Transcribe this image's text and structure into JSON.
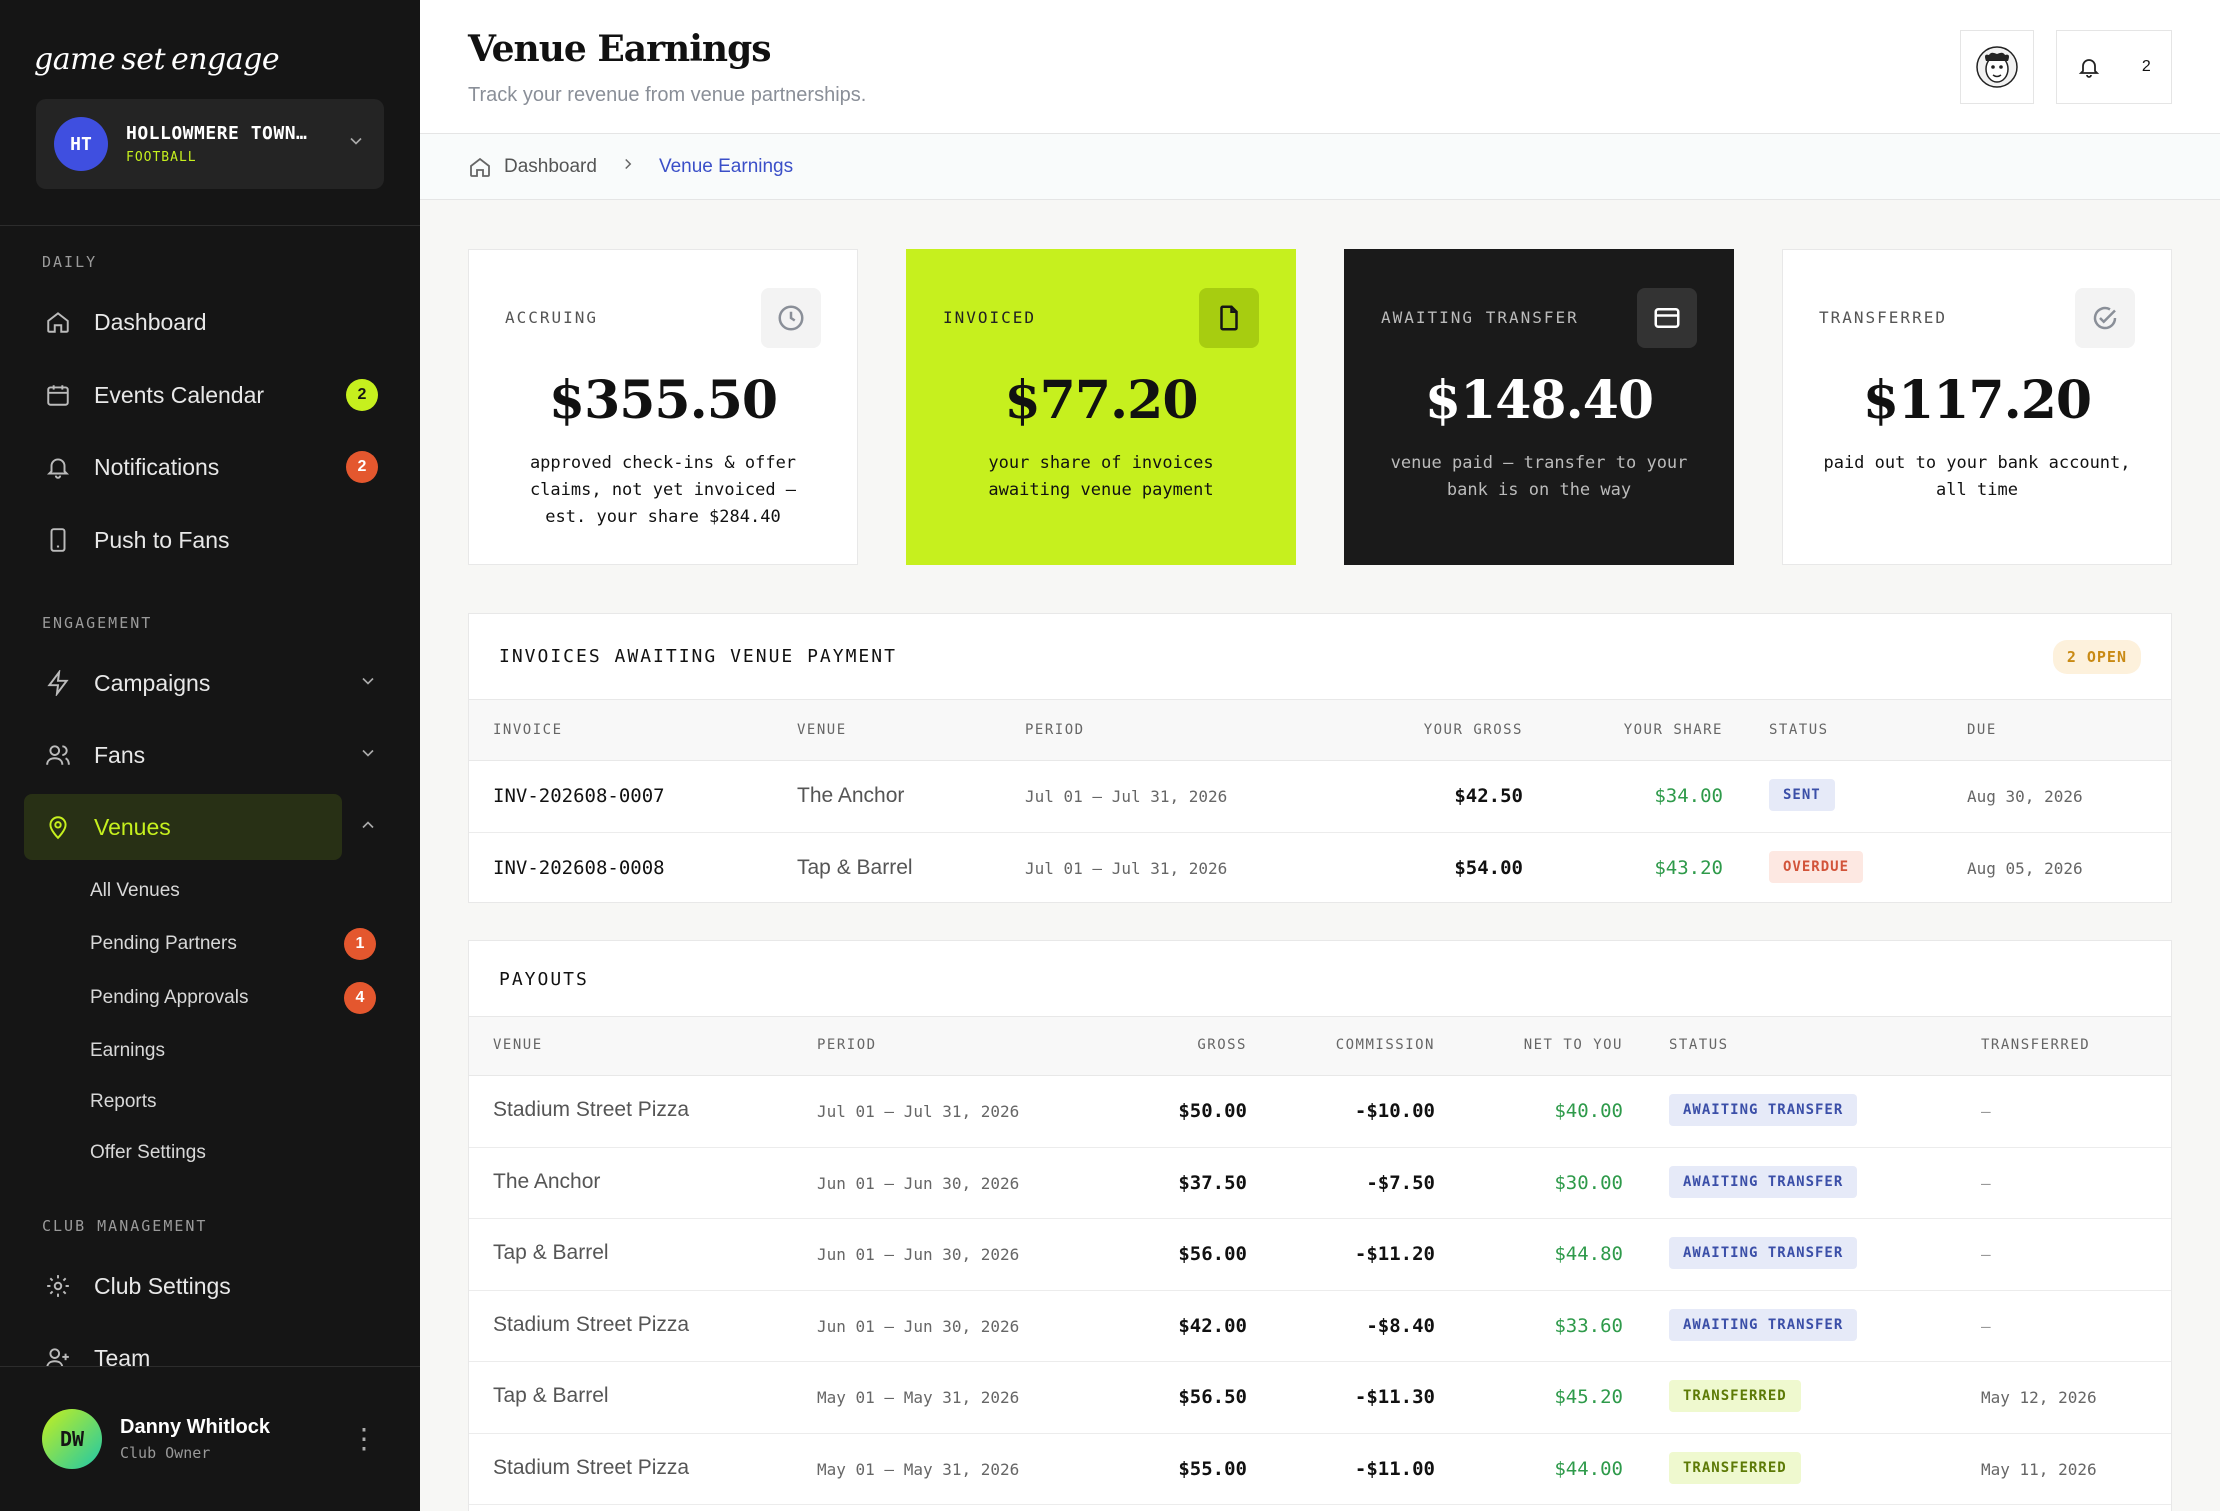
{
  "brand": {
    "logo_words": [
      "game",
      "set",
      "engage"
    ]
  },
  "club": {
    "initials": "HT",
    "name": "HOLLOWMERE TOWN…",
    "sport": "FOOTBALL"
  },
  "sidebar": {
    "sections": {
      "daily": "DAILY",
      "engagement": "ENGAGEMENT",
      "club": "CLUB MANAGEMENT"
    },
    "items": {
      "dashboard": "Dashboard",
      "events": {
        "label": "Events Calendar",
        "badge": "2"
      },
      "notifications": {
        "label": "Notifications",
        "badge": "2"
      },
      "push": "Push to Fans",
      "campaigns": "Campaigns",
      "fans": "Fans",
      "venues": "Venues",
      "club_settings": "Club Settings",
      "team": "Team"
    },
    "venue_sub": {
      "all": "All Venues",
      "pending_partners": {
        "label": "Pending Partners",
        "badge": "1"
      },
      "pending_approvals": {
        "label": "Pending Approvals",
        "badge": "4"
      },
      "earnings": "Earnings",
      "reports": "Reports",
      "offer_settings": "Offer Settings"
    }
  },
  "user": {
    "initials": "DW",
    "name": "Danny Whitlock",
    "role": "Club Owner"
  },
  "header": {
    "title": "Venue Earnings",
    "subtitle": "Track your revenue from venue partnerships.",
    "notif_count": "2"
  },
  "breadcrumb": {
    "home": "Dashboard",
    "current": "Venue Earnings"
  },
  "cards": [
    {
      "label": "ACCRUING",
      "amount": "$355.50",
      "desc": "approved check-ins & offer claims, not yet invoiced — est. your share $284.40",
      "icon": "clock-icon"
    },
    {
      "label": "INVOICED",
      "amount": "$77.20",
      "desc": "your share of invoices awaiting venue payment",
      "icon": "document-icon"
    },
    {
      "label": "AWAITING TRANSFER",
      "amount": "$148.40",
      "desc": "venue paid — transfer to your bank is on the way",
      "icon": "credit-card-icon"
    },
    {
      "label": "TRANSFERRED",
      "amount": "$117.20",
      "desc": "paid out to your bank account, all time",
      "icon": "check-circle-icon"
    }
  ],
  "invoices": {
    "title": "INVOICES AWAITING VENUE PAYMENT",
    "badge": "2 OPEN",
    "columns": [
      "INVOICE",
      "VENUE",
      "PERIOD",
      "YOUR GROSS",
      "YOUR SHARE",
      "STATUS",
      "DUE"
    ],
    "rows": [
      {
        "invoice": "INV-202608-0007",
        "venue": "The Anchor",
        "period": "Jul 01 — Jul 31, 2026",
        "gross": "$42.50",
        "share": "$34.00",
        "status": "SENT",
        "due": "Aug 30, 2026"
      },
      {
        "invoice": "INV-202608-0008",
        "venue": "Tap & Barrel",
        "period": "Jul 01 — Jul 31, 2026",
        "gross": "$54.00",
        "share": "$43.20",
        "status": "OVERDUE",
        "due": "Aug 05, 2026"
      }
    ]
  },
  "payouts": {
    "title": "PAYOUTS",
    "columns": [
      "VENUE",
      "PERIOD",
      "GROSS",
      "COMMISSION",
      "NET TO YOU",
      "STATUS",
      "TRANSFERRED"
    ],
    "rows": [
      {
        "venue": "Stadium Street Pizza",
        "period": "Jul 01 — Jul 31, 2026",
        "gross": "$50.00",
        "commission": "-$10.00",
        "net": "$40.00",
        "status": "AWAITING TRANSFER",
        "transferred": "—"
      },
      {
        "venue": "The Anchor",
        "period": "Jun 01 — Jun 30, 2026",
        "gross": "$37.50",
        "commission": "-$7.50",
        "net": "$30.00",
        "status": "AWAITING TRANSFER",
        "transferred": "—"
      },
      {
        "venue": "Tap & Barrel",
        "period": "Jun 01 — Jun 30, 2026",
        "gross": "$56.00",
        "commission": "-$11.20",
        "net": "$44.80",
        "status": "AWAITING TRANSFER",
        "transferred": "—"
      },
      {
        "venue": "Stadium Street Pizza",
        "period": "Jun 01 — Jun 30, 2026",
        "gross": "$42.00",
        "commission": "-$8.40",
        "net": "$33.60",
        "status": "AWAITING TRANSFER",
        "transferred": "—"
      },
      {
        "venue": "Tap & Barrel",
        "period": "May 01 — May 31, 2026",
        "gross": "$56.50",
        "commission": "-$11.30",
        "net": "$45.20",
        "status": "TRANSFERRED",
        "transferred": "May 12, 2026"
      },
      {
        "venue": "Stadium Street Pizza",
        "period": "May 01 — May 31, 2026",
        "gross": "$55.00",
        "commission": "-$11.00",
        "net": "$44.00",
        "status": "TRANSFERRED",
        "transferred": "May 11, 2026"
      }
    ]
  }
}
